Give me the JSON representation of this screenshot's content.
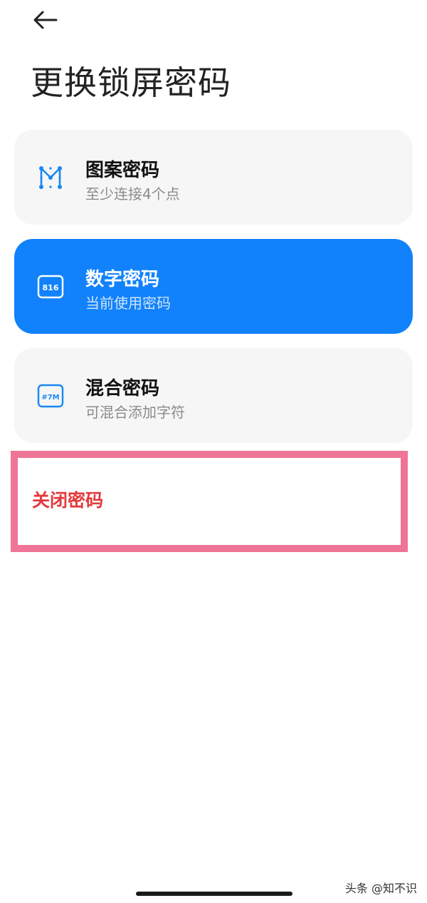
{
  "header": {
    "back_icon": "arrow-left-icon",
    "title": "更换锁屏密码"
  },
  "options": [
    {
      "icon": "pattern-icon",
      "title": "图案密码",
      "subtitle": "至少连接4个点",
      "selected": false
    },
    {
      "icon": "numeric-icon",
      "icon_text": "816",
      "title": "数字密码",
      "subtitle": "当前使用密码",
      "selected": true
    },
    {
      "icon": "mixed-icon",
      "icon_text": "#7M",
      "title": "混合密码",
      "subtitle": "可混合添加字符",
      "selected": false
    }
  ],
  "close_password": {
    "label": "关闭密码"
  },
  "watermark": "头条 @知不识",
  "colors": {
    "accent": "#1182fb",
    "card_bg": "#f6f6f6",
    "danger": "#e3393c",
    "highlight_border": "#ef7597"
  }
}
